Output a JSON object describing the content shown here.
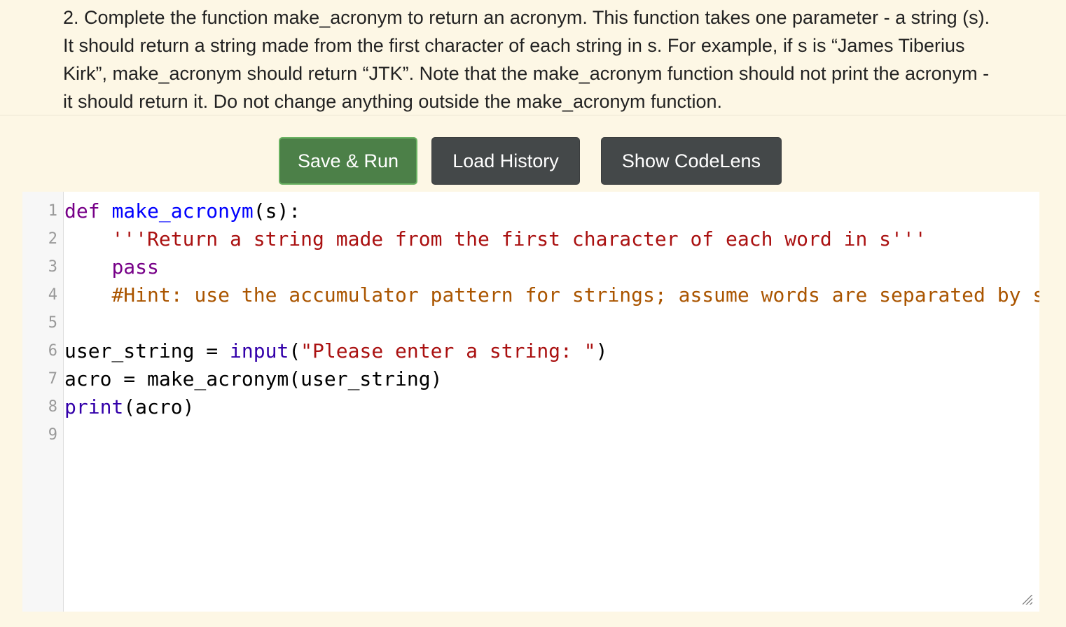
{
  "question": {
    "text": "2. Complete the function make_acronym to return an acronym. This function takes one parameter - a string (s). It should return a string made from the first character of each string in s. For example, if s is “James Tiberius Kirk”, make_acronym should return “JTK”. Note that the make_acronym function should not print the acronym - it should return it. Do not change anything outside the make_acronym function."
  },
  "toolbar": {
    "save_run_label": "Save & Run",
    "load_history_label": "Load History",
    "show_codelens_label": "Show CodeLens"
  },
  "editor": {
    "line_numbers": [
      "1",
      "2",
      "3",
      "4",
      "5",
      "6",
      "7",
      "8",
      "9"
    ],
    "lines": [
      [
        {
          "t": "def",
          "c": "kw"
        },
        {
          "t": " "
        },
        {
          "t": "make_acronym",
          "c": "def"
        },
        {
          "t": "(s):"
        }
      ],
      [
        {
          "t": "    "
        },
        {
          "t": "'''Return a string made from the first character of each word in s'''",
          "c": "str"
        }
      ],
      [
        {
          "t": "    "
        },
        {
          "t": "pass",
          "c": "kw"
        }
      ],
      [
        {
          "t": "    "
        },
        {
          "t": "#Hint: use the accumulator pattern for strings; assume words are separated by s",
          "c": "cmt"
        }
      ],
      [],
      [
        {
          "t": "user_string = "
        },
        {
          "t": "input",
          "c": "builtin"
        },
        {
          "t": "("
        },
        {
          "t": "\"Please enter a string: \"",
          "c": "str"
        },
        {
          "t": ")"
        }
      ],
      [
        {
          "t": "acro = make_acronym(user_string)"
        }
      ],
      [
        {
          "t": "print",
          "c": "builtin"
        },
        {
          "t": "(acro)"
        }
      ],
      []
    ]
  },
  "colors": {
    "page_background": "#fdf7e5",
    "save_button": "#4c8048",
    "dark_button": "#444849",
    "keyword": "#770088",
    "function_name": "#0000ff",
    "builtin": "#3300aa",
    "string": "#aa1111",
    "comment": "#aa5500"
  }
}
